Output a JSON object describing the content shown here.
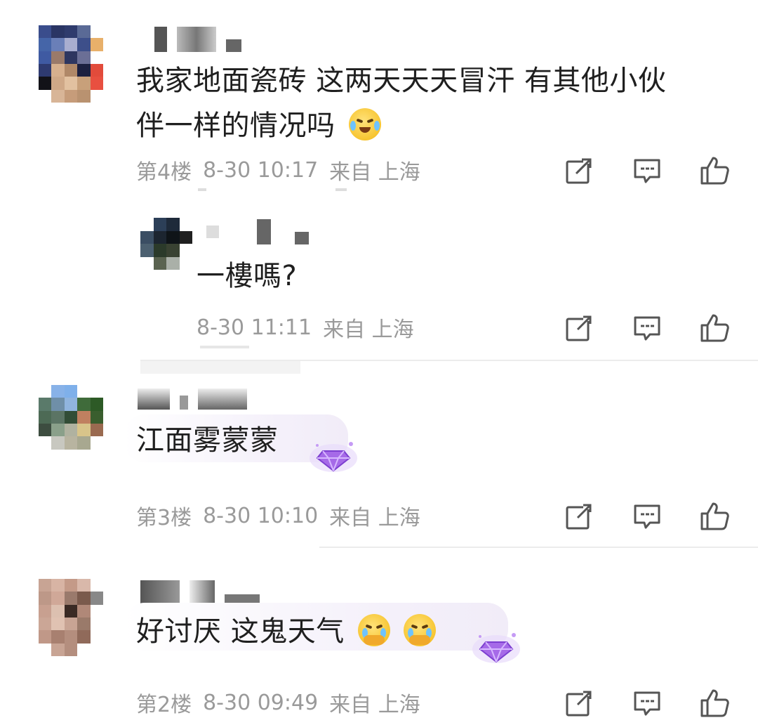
{
  "comments": [
    {
      "text_line1": "我家地面瓷砖 这两天天天冒汗 有其他小伙",
      "text_line2": "伴一样的情况吗",
      "floor": "第4楼",
      "time": "8-30 10:17",
      "from": "来自 上海",
      "emoji": "laugh-cry-emoji",
      "reply": {
        "text": "一樓嗎?",
        "time": "8-30 11:11",
        "from": "来自 上海"
      }
    },
    {
      "text": "江面雾蒙蒙",
      "floor": "第3楼",
      "time": "8-30 10:10",
      "from": "来自 上海",
      "badge": "diamond-badge-icon"
    },
    {
      "text": "好讨厌 这鬼天气",
      "floor": "第2楼",
      "time": "8-30 09:49",
      "from": "来自 上海",
      "emoji": "crying-hands-emoji",
      "badge": "diamond-badge-icon"
    }
  ],
  "action_icons": [
    "share-icon",
    "comment-icon",
    "like-icon"
  ],
  "colors": {
    "meta_gray": "#9a9a9a",
    "icon_gray": "#555555",
    "badge_purple": "#b57cf0"
  }
}
